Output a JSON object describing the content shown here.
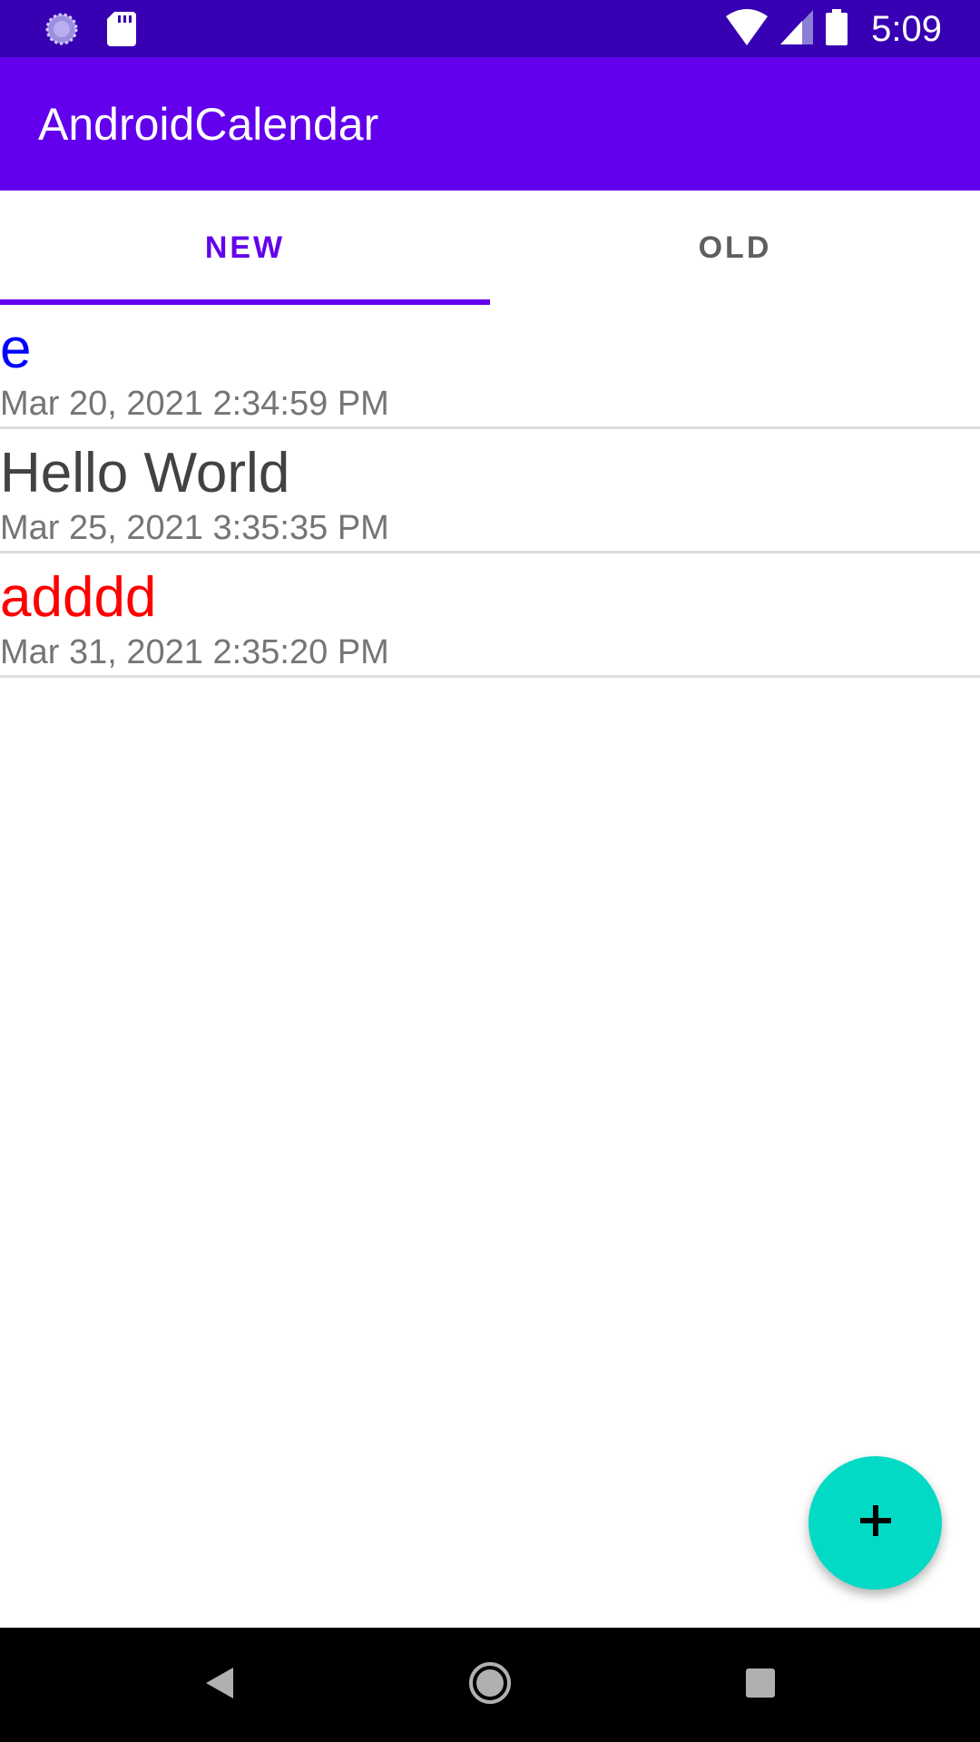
{
  "status_bar": {
    "time": "5:09",
    "icons": [
      "loading-icon",
      "sd-card-icon",
      "wifi-icon",
      "signal-icon",
      "battery-icon"
    ]
  },
  "app_bar": {
    "title": "AndroidCalendar"
  },
  "tabs": [
    {
      "label": "NEW",
      "selected": true
    },
    {
      "label": "OLD",
      "selected": false
    }
  ],
  "events": [
    {
      "title": "e",
      "date": "Mar 20, 2021 2:34:59 PM",
      "color": "#0000ff"
    },
    {
      "title": "Hello World",
      "date": "Mar 25, 2021 3:35:35 PM",
      "color": "#424242"
    },
    {
      "title": "adddd",
      "date": "Mar 31, 2021 2:35:20 PM",
      "color": "#ff0000"
    }
  ],
  "fab": {
    "icon": "plus-icon",
    "color": "#03dac5"
  },
  "nav_bar": {
    "icons": [
      "back-icon",
      "home-icon",
      "recents-icon"
    ]
  },
  "colors": {
    "primary": "#6200ee",
    "primary_dark": "#3700b3",
    "accent": "#03dac5"
  }
}
